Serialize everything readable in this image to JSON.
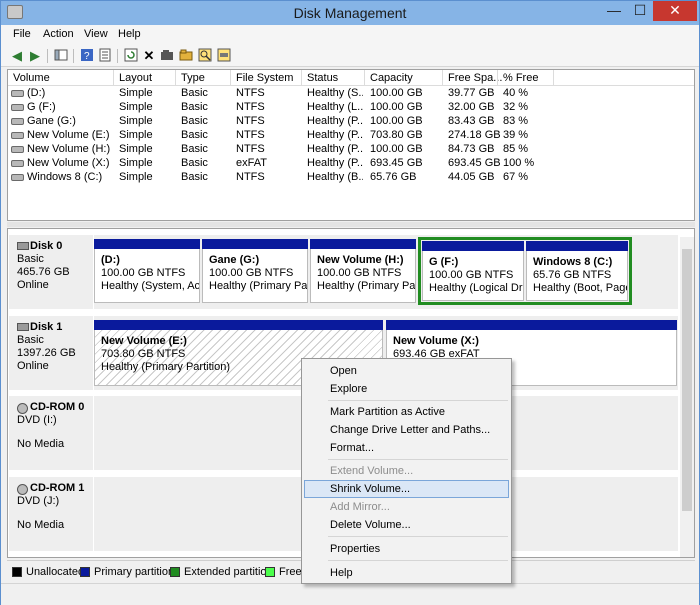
{
  "window": {
    "title": "Disk Management",
    "controls": {
      "minimize": "—",
      "maximize": "☐",
      "close": "✕"
    }
  },
  "menu": [
    "File",
    "Action",
    "View",
    "Help"
  ],
  "toolbar_icons": [
    "back-icon",
    "forward-icon",
    "console-tree-icon",
    "help-icon",
    "properties-icon",
    "refresh-icon",
    "delete-icon",
    "open-icon",
    "explore-icon",
    "search-icon",
    "disk-icon"
  ],
  "volume_table": {
    "columns": [
      "Volume",
      "Layout",
      "Type",
      "File System",
      "Status",
      "Capacity",
      "Free Spa...",
      "% Free"
    ],
    "rows": [
      [
        "(D:)",
        "Simple",
        "Basic",
        "NTFS",
        "Healthy (S...",
        "100.00 GB",
        "39.77 GB",
        "40 %"
      ],
      [
        "G (F:)",
        "Simple",
        "Basic",
        "NTFS",
        "Healthy (L...",
        "100.00 GB",
        "32.00 GB",
        "32 %"
      ],
      [
        "Gane (G:)",
        "Simple",
        "Basic",
        "NTFS",
        "Healthy (P...",
        "100.00 GB",
        "83.43 GB",
        "83 %"
      ],
      [
        "New Volume (E:)",
        "Simple",
        "Basic",
        "NTFS",
        "Healthy (P...",
        "703.80 GB",
        "274.18 GB",
        "39 %"
      ],
      [
        "New Volume (H:)",
        "Simple",
        "Basic",
        "NTFS",
        "Healthy (P...",
        "100.00 GB",
        "84.73 GB",
        "85 %"
      ],
      [
        "New Volume (X:)",
        "Simple",
        "Basic",
        "exFAT",
        "Healthy (P...",
        "693.45 GB",
        "693.45 GB",
        "100 %"
      ],
      [
        "Windows 8 (C:)",
        "Simple",
        "Basic",
        "NTFS",
        "Healthy (B...",
        "65.76 GB",
        "44.05 GB",
        "67 %"
      ]
    ]
  },
  "disks": [
    {
      "name": "Disk 0",
      "type": "Basic",
      "size": "465.76 GB",
      "state": "Online",
      "partitions": [
        {
          "name": "(D:)",
          "size": "100.00 GB NTFS",
          "status": "Healthy (System, Activ"
        },
        {
          "name": "Gane  (G:)",
          "size": "100.00 GB NTFS",
          "status": "Healthy (Primary Parti"
        },
        {
          "name": "New Volume  (H:)",
          "size": "100.00 GB NTFS",
          "status": "Healthy (Primary Parti"
        },
        {
          "name": "G  (F:)",
          "size": "100.00 GB NTFS",
          "status": "Healthy (Logical Drive"
        },
        {
          "name": "Windows 8  (C:)",
          "size": "65.76 GB NTFS",
          "status": "Healthy (Boot, Page F"
        }
      ]
    },
    {
      "name": "Disk 1",
      "type": "Basic",
      "size": "1397.26 GB",
      "state": "Online",
      "partitions": [
        {
          "name": "New Volume  (E:)",
          "size": "703.80 GB NTFS",
          "status": "Healthy (Primary Partition)"
        },
        {
          "name": "New Volume  (X:)",
          "size": "693.46 GB exFAT",
          "status": ""
        }
      ]
    },
    {
      "name": "CD-ROM 0",
      "type": "DVD (I:)",
      "state": "No Media"
    },
    {
      "name": "CD-ROM 1",
      "type": "DVD (J:)",
      "state": "No Media"
    }
  ],
  "legend": [
    {
      "label": "Unallocated",
      "color": "#000000"
    },
    {
      "label": "Primary partition",
      "color": "#0a1a9c"
    },
    {
      "label": "Extended partition",
      "color": "#218c21"
    },
    {
      "label": "Free",
      "color": "#4cff4c"
    }
  ],
  "context_menu": {
    "items": [
      {
        "label": "Open",
        "enabled": true
      },
      {
        "label": "Explore",
        "enabled": true
      },
      {
        "label": "Mark Partition as Active",
        "enabled": true
      },
      {
        "label": "Change Drive Letter and Paths...",
        "enabled": true
      },
      {
        "label": "Format...",
        "enabled": true
      },
      {
        "label": "Extend Volume...",
        "enabled": false
      },
      {
        "label": "Shrink Volume...",
        "enabled": true,
        "highlighted": true
      },
      {
        "label": "Add Mirror...",
        "enabled": false
      },
      {
        "label": "Delete Volume...",
        "enabled": true
      },
      {
        "label": "Properties",
        "enabled": true
      },
      {
        "label": "Help",
        "enabled": true
      }
    ]
  }
}
